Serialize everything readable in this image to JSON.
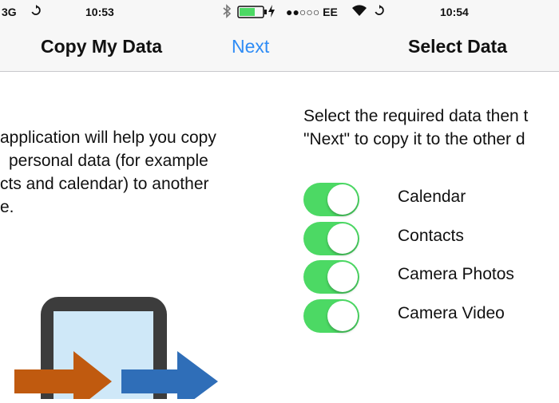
{
  "left_screen": {
    "status": {
      "network": "3G",
      "time": "10:53"
    },
    "nav": {
      "title": "Copy My Data",
      "next": "Next"
    },
    "body_lines": [
      "application will help you copy",
      "personal data (for example",
      "cts and calendar) to another",
      "e."
    ],
    "arrow_colors": [
      "#c05a0f",
      "#2f6eb8"
    ]
  },
  "right_screen": {
    "status": {
      "carrier": "●●○○○ EE",
      "time": "10:54"
    },
    "nav": {
      "title": "Select Data"
    },
    "instruction_lines": [
      "Select the required data then t",
      "\"Next\" to copy it to the other d"
    ],
    "items": [
      {
        "label": "Calendar",
        "enabled": true
      },
      {
        "label": "Contacts",
        "enabled": true
      },
      {
        "label": "Camera Photos",
        "enabled": true
      },
      {
        "label": "Camera Video",
        "enabled": true
      }
    ]
  },
  "icons": {
    "sync": "sync-icon",
    "bluetooth": "bluetooth-icon",
    "battery": "battery-icon",
    "charging": "charging-bolt-icon",
    "wifi": "wifi-icon"
  },
  "colors": {
    "accent": "#2f8cf5",
    "toggle_on": "#4cd964"
  }
}
